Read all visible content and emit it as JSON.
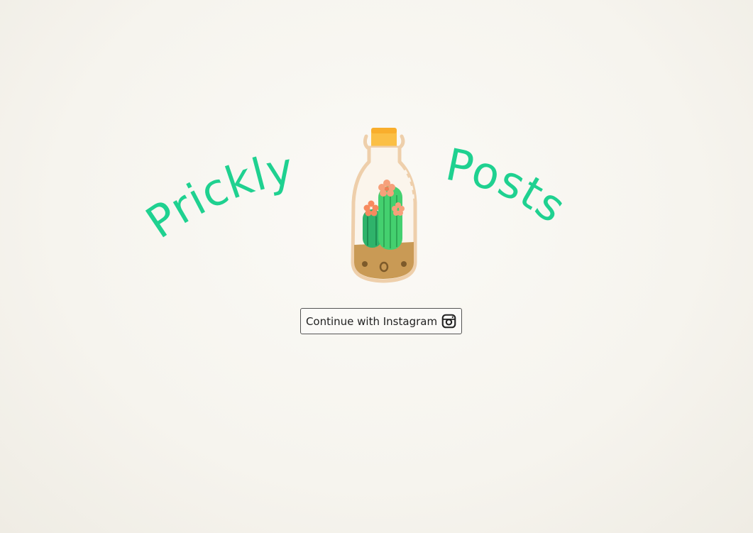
{
  "logo": {
    "word_left": "Prickly",
    "word_right": "Posts",
    "illustration": "cactus-in-bottle",
    "text_color": "#1fd190"
  },
  "login": {
    "button_label": "Continue with Instagram",
    "button_icon": "instagram-icon"
  }
}
